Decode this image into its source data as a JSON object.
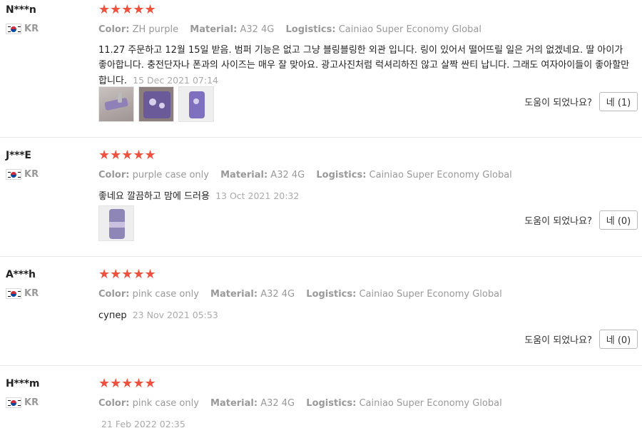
{
  "reviews": [
    {
      "user": "N***n",
      "country": "KR",
      "stars": "★★★★★",
      "color_label": "Color:",
      "color_value": "ZH purple",
      "material_label": "Material:",
      "material_value": "A32 4G",
      "logistics_label": "Logistics:",
      "logistics_value": "Cainiao Super Economy Global",
      "text": "11.27 주문하고 12월 15일 받음. 범퍼 기능은 없고 그냥 블링블링한 외관 입니다. 링이 있어서 떨어뜨릴 일은 거의 없겠네요. 딸 아이가 좋아합니다. 충전단자나 폰과의 사이즈는 매우 잘 맞아요. 광고사진처럼 럭셔리하진 않고 살짝 싼티 납니다. 그래도 여자아이들이 좋아할만 합니다.",
      "date": "15 Dec 2021 07:14",
      "helpful_label": "도움이 되었나요?",
      "helpful_button": "네 (1)"
    },
    {
      "user": "J***E",
      "country": "KR",
      "stars": "★★★★★",
      "color_label": "Color:",
      "color_value": "purple case only",
      "material_label": "Material:",
      "material_value": "A32 4G",
      "logistics_label": "Logistics:",
      "logistics_value": "Cainiao Super Economy Global",
      "text": "좋네요 깔끔하고 맘에 드러용",
      "date": "13 Oct 2021 20:32",
      "helpful_label": "도움이 되었나요?",
      "helpful_button": "네 (0)"
    },
    {
      "user": "A***h",
      "country": "KR",
      "stars": "★★★★★",
      "color_label": "Color:",
      "color_value": "pink case only",
      "material_label": "Material:",
      "material_value": "A32 4G",
      "logistics_label": "Logistics:",
      "logistics_value": "Cainiao Super Economy Global",
      "text": "супер",
      "date": "23 Nov 2021 05:53",
      "helpful_label": "도움이 되었나요?",
      "helpful_button": "네 (0)"
    },
    {
      "user": "H***m",
      "country": "KR",
      "stars": "★★★★★",
      "color_label": "Color:",
      "color_value": "pink case only",
      "material_label": "Material:",
      "material_value": "A32 4G",
      "logistics_label": "Logistics:",
      "logistics_value": "Cainiao Super Economy Global",
      "text": "",
      "date": "21 Feb 2022 02:35"
    }
  ],
  "colors": {
    "star": "#f0513f",
    "muted": "#999999",
    "divider": "#e8e8e8"
  }
}
